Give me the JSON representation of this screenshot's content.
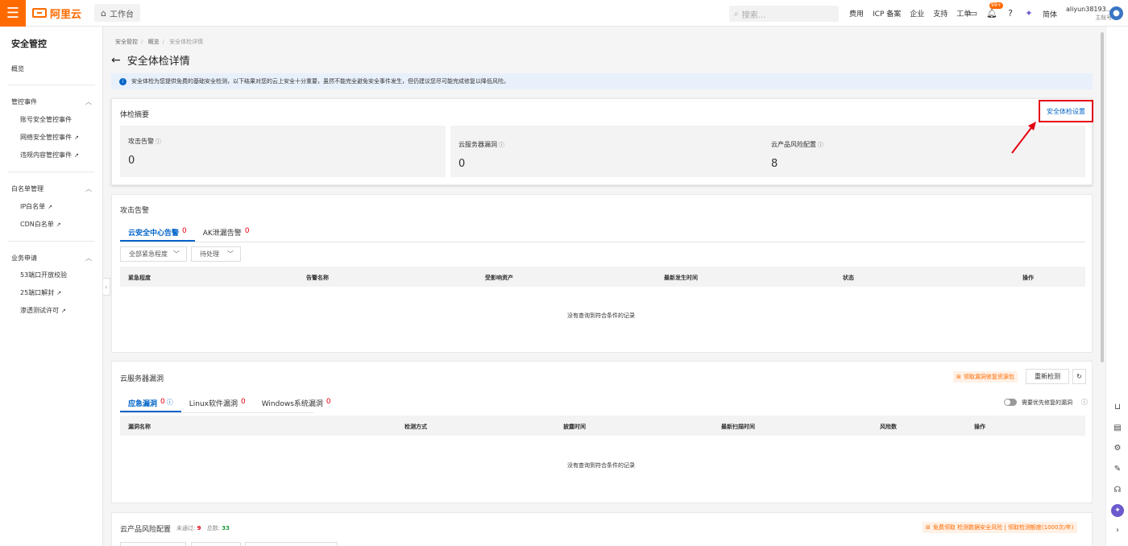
{
  "topbar": {
    "logo": "阿里云",
    "workbench": "工作台",
    "search_placeholder": "搜索...",
    "links": [
      "费用",
      "ICP 备案",
      "企业",
      "支持",
      "工单"
    ],
    "badge": "99+",
    "lang": "简体",
    "user_name": "aliyun38193...",
    "user_role": "主账号"
  },
  "sidebar": {
    "title": "安全管控",
    "overview": "概览",
    "groups": [
      {
        "label": "管控事件",
        "items": [
          "账号安全管控事件",
          "网络安全管控事件",
          "违规内容管控事件"
        ]
      },
      {
        "label": "白名单管理",
        "items": [
          "IP白名单",
          "CDN白名单"
        ]
      },
      {
        "label": "业务申请",
        "items": [
          "53端口开放校验",
          "25端口解封",
          "渗透测试许可"
        ]
      }
    ]
  },
  "breadcrumb": [
    "安全管控",
    "概览",
    "安全体检详情"
  ],
  "page_title": "安全体检详情",
  "notice": "安全体检为您提供免费的基础安全检测，以下结果对您的云上安全十分重要，虽然不能完全避免安全事件发生，但仍建议您尽可能完成修复以降低风险。",
  "summary": {
    "title": "体检摘要",
    "setting_link": "安全体检设置",
    "boxes": [
      {
        "label": "攻击告警",
        "value": "0"
      },
      {
        "label": "云服务器漏洞",
        "value": "0"
      },
      {
        "label": "云产品风险配置",
        "value": "8"
      }
    ]
  },
  "attack": {
    "title": "攻击告警",
    "tabs": [
      {
        "label": "云安全中心告警",
        "count": "0"
      },
      {
        "label": "AK泄漏告警",
        "count": "0"
      }
    ],
    "filters": [
      "全部紧急程度",
      "待处理"
    ],
    "columns": [
      "紧急程度",
      "告警名称",
      "受影响资产",
      "最新发生时间",
      "状态",
      "操作"
    ],
    "empty": "没有查询到符合条件的记录"
  },
  "vuln": {
    "title": "云服务器漏洞",
    "promo": "领取漏洞修复资源包",
    "recheck": "重新检测",
    "tabs": [
      {
        "label": "应急漏洞",
        "count": "0"
      },
      {
        "label": "Linux软件漏洞",
        "count": "0"
      },
      {
        "label": "Windows系统漏洞",
        "count": "0"
      }
    ],
    "toggle_label": "需要优先修复的漏洞",
    "columns": [
      "漏洞名称",
      "检测方式",
      "披露时间",
      "最新扫描时间",
      "风险数",
      "操作"
    ],
    "empty": "没有查询到符合条件的记录"
  },
  "config": {
    "title": "云产品风险配置",
    "failed_label": "未通过:",
    "failed": "9",
    "total_label": "总数:",
    "total": "33",
    "promo": "免费领取 检测数据安全风险 | 领取检测额度(1000次/年)"
  }
}
